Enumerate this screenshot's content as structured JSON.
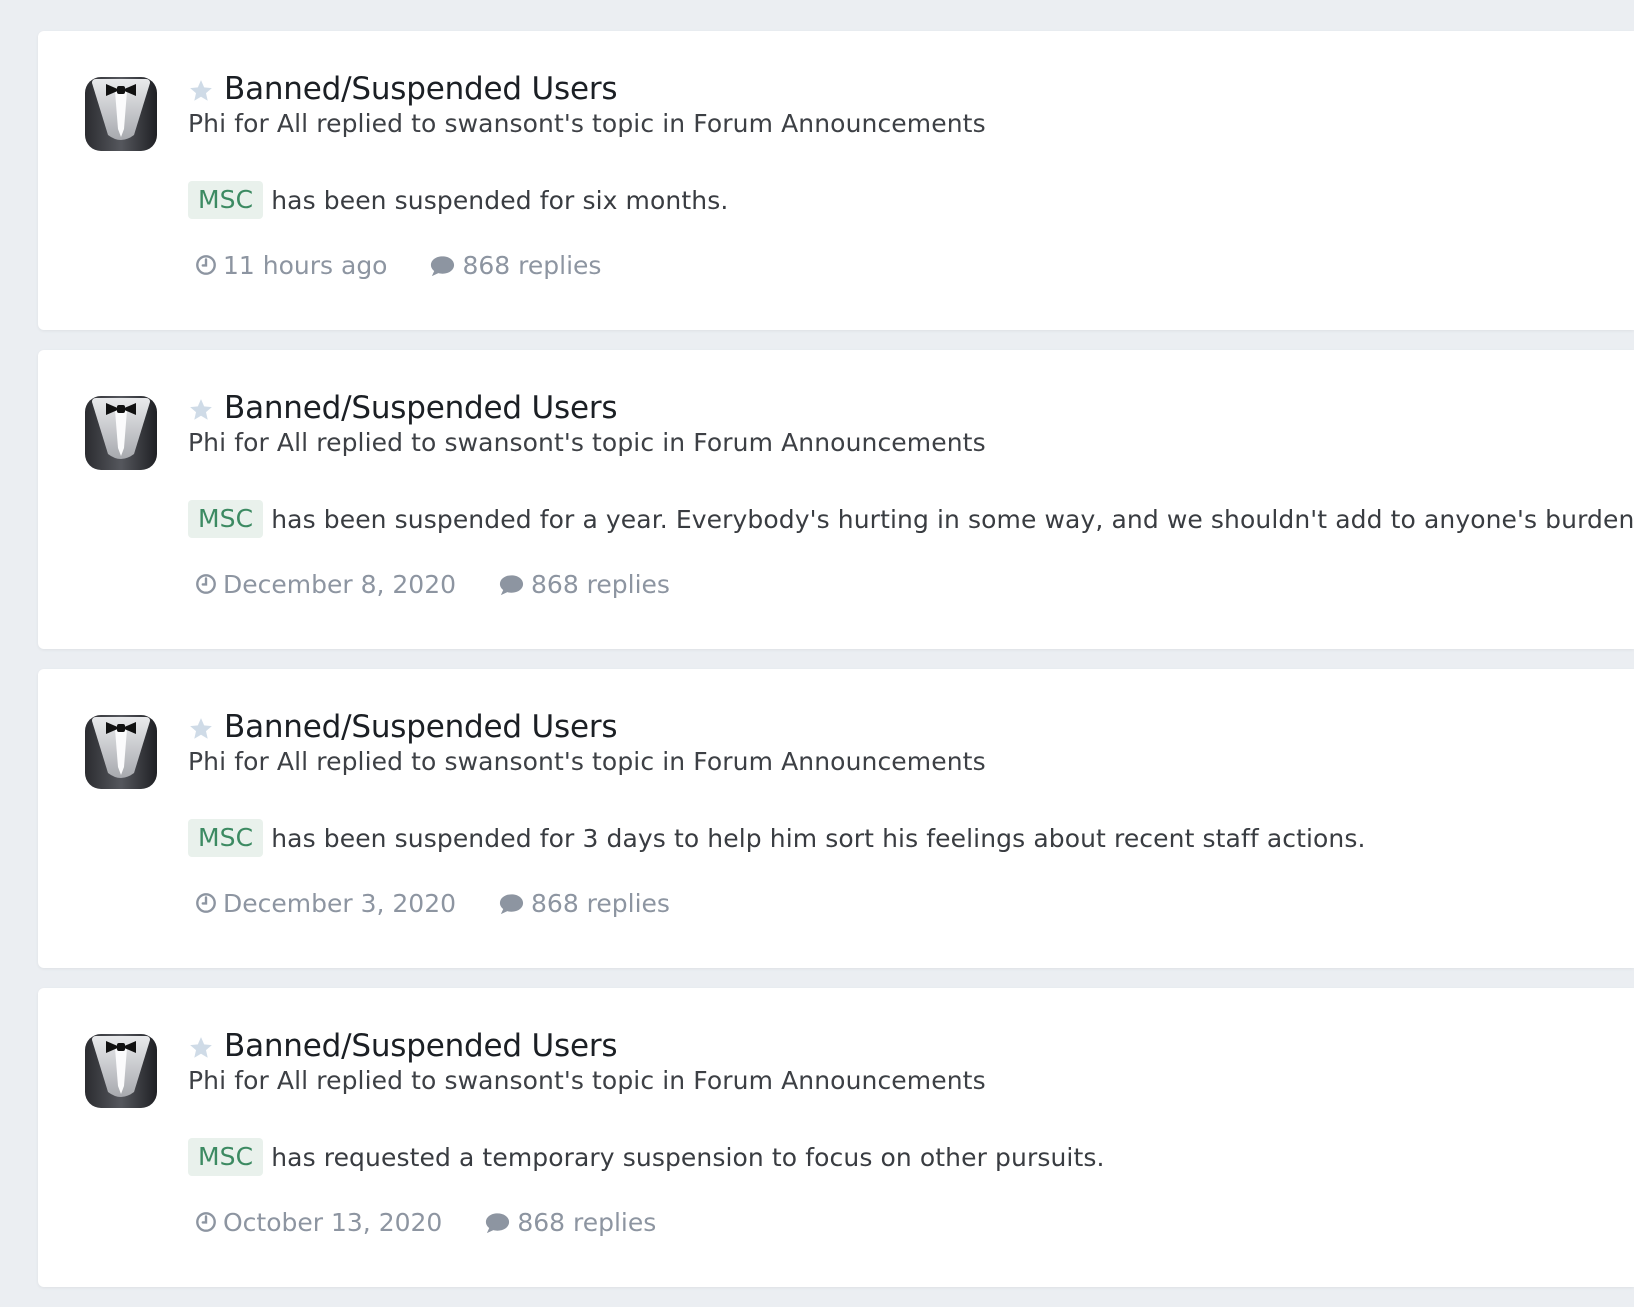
{
  "colors": {
    "page_background": "#ebeef2",
    "card_background": "#ffffff",
    "tag_background": "#e9f1ec",
    "tag_text": "#3c8a62",
    "meta_text": "#8d95a1",
    "star": "#cfdbe7"
  },
  "icons": {
    "avatar": "tuxedo-avatar-icon",
    "star": "star-icon",
    "time": "clock-icon",
    "replies": "speech-bubble-icon"
  },
  "activity": [
    {
      "title": "Banned/Suspended Users",
      "summary": "Phi for All replied to swansont's topic in Forum Announcements",
      "tag": "MSC",
      "snippet": "has been suspended for six months.",
      "time": "11 hours ago",
      "replies": "868 replies"
    },
    {
      "title": "Banned/Suspended Users",
      "summary": "Phi for All replied to swansont's topic in Forum Announcements",
      "tag": "MSC",
      "snippet": "has been suspended for a year. Everybody's hurting in some way, and we shouldn't add to anyone's burden.",
      "time": "December 8, 2020",
      "replies": "868 replies"
    },
    {
      "title": "Banned/Suspended Users",
      "summary": "Phi for All replied to swansont's topic in Forum Announcements",
      "tag": "MSC",
      "snippet": "has been suspended for 3 days to help him sort his feelings about recent staff actions.",
      "time": "December 3, 2020",
      "replies": "868 replies"
    },
    {
      "title": "Banned/Suspended Users",
      "summary": "Phi for All replied to swansont's topic in Forum Announcements",
      "tag": "MSC",
      "snippet": "has requested a temporary suspension to focus on other pursuits.",
      "time": "October 13, 2020",
      "replies": "868 replies"
    }
  ]
}
